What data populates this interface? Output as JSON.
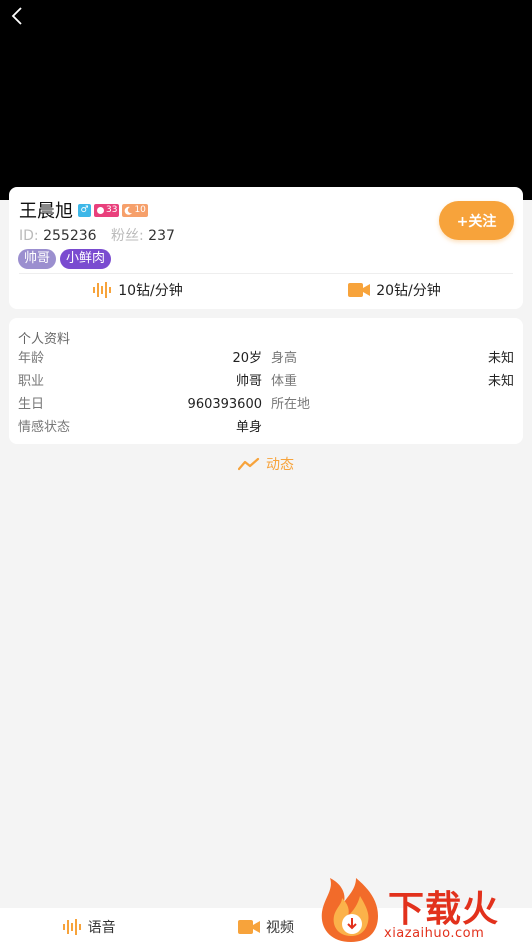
{
  "profile": {
    "name": "王晨旭",
    "badges": {
      "gender": "♂",
      "wealth_level": "33",
      "charm_level": "10"
    },
    "id_label": "ID:",
    "id_value": "255236",
    "fans_label": "粉丝:",
    "fans_value": "237",
    "tags": [
      "帅哥",
      "小鲜肉"
    ],
    "follow_label": "+关注",
    "voice_price": "10钻/分钟",
    "video_price": "20钻/分钟"
  },
  "info": {
    "title": "个人资料",
    "rows": [
      {
        "k1": "年龄",
        "v1": "20岁",
        "k2": "身高",
        "v2": "未知"
      },
      {
        "k1": "职业",
        "v1": "帅哥",
        "k2": "体重",
        "v2": "未知"
      },
      {
        "k1": "生日",
        "v1": "960393600",
        "k2": "所在地",
        "v2": ""
      },
      {
        "k1": "情感状态",
        "v1": "单身",
        "k2": "",
        "v2": ""
      }
    ]
  },
  "dynamic_label": "动态",
  "bottom": {
    "voice": "语音",
    "video": "视频"
  },
  "watermark": {
    "title": "下载火",
    "url": "xiazaihuo.com"
  },
  "colors": {
    "accent": "#f7a33b",
    "hero": "#000000",
    "watermark": "#e2311c"
  }
}
